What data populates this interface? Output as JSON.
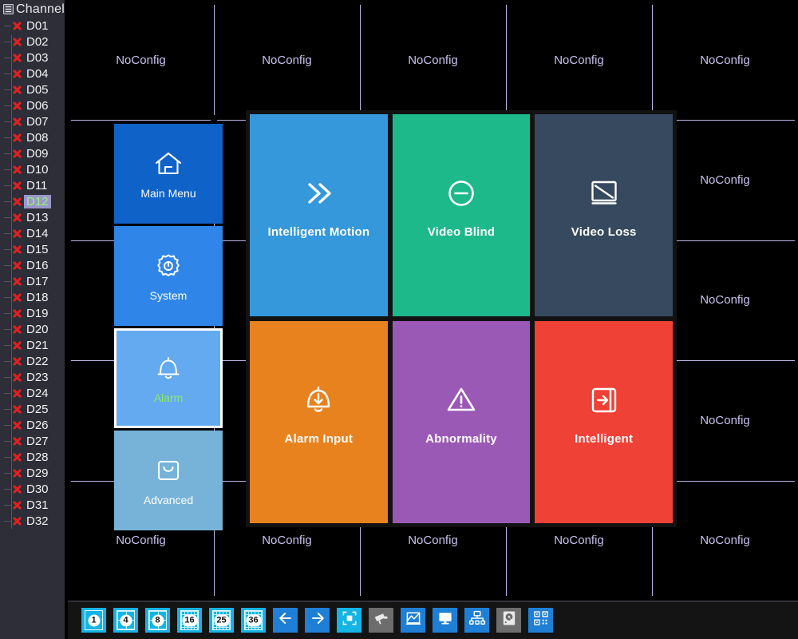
{
  "sidebar": {
    "header": {
      "label": "Channel",
      "icon": "list-document-icon"
    },
    "selected_channel": "D12",
    "channels": [
      {
        "id": "D01",
        "status": "offline"
      },
      {
        "id": "D02",
        "status": "offline"
      },
      {
        "id": "D03",
        "status": "offline"
      },
      {
        "id": "D04",
        "status": "offline"
      },
      {
        "id": "D05",
        "status": "offline"
      },
      {
        "id": "D06",
        "status": "offline"
      },
      {
        "id": "D07",
        "status": "offline"
      },
      {
        "id": "D08",
        "status": "offline"
      },
      {
        "id": "D09",
        "status": "offline"
      },
      {
        "id": "D10",
        "status": "offline"
      },
      {
        "id": "D11",
        "status": "offline"
      },
      {
        "id": "D12",
        "status": "offline"
      },
      {
        "id": "D13",
        "status": "offline"
      },
      {
        "id": "D14",
        "status": "offline"
      },
      {
        "id": "D15",
        "status": "offline"
      },
      {
        "id": "D16",
        "status": "offline"
      },
      {
        "id": "D17",
        "status": "offline"
      },
      {
        "id": "D18",
        "status": "offline"
      },
      {
        "id": "D19",
        "status": "offline"
      },
      {
        "id": "D20",
        "status": "offline"
      },
      {
        "id": "D21",
        "status": "offline"
      },
      {
        "id": "D22",
        "status": "offline"
      },
      {
        "id": "D23",
        "status": "offline"
      },
      {
        "id": "D24",
        "status": "offline"
      },
      {
        "id": "D25",
        "status": "offline"
      },
      {
        "id": "D26",
        "status": "offline"
      },
      {
        "id": "D27",
        "status": "offline"
      },
      {
        "id": "D28",
        "status": "offline"
      },
      {
        "id": "D29",
        "status": "offline"
      },
      {
        "id": "D30",
        "status": "offline"
      },
      {
        "id": "D31",
        "status": "offline"
      },
      {
        "id": "D32",
        "status": "offline"
      }
    ]
  },
  "video_grid": {
    "cell_placeholder": "NoConfig",
    "columns": 5,
    "rows": 5,
    "cells": [
      "NoConfig",
      "NoConfig",
      "NoConfig",
      "NoConfig",
      "NoConfig",
      "NoConfig",
      "NoConfig",
      "NoConfig",
      "NoConfig",
      "NoConfig",
      "NoConfig",
      "NoConfig",
      "NoConfig",
      "NoConfig",
      "NoConfig",
      "NoConfig",
      "NoConfig",
      "NoConfig",
      "NoConfig",
      "NoConfig",
      "NoConfig",
      "NoConfig",
      "NoConfig",
      "NoConfig",
      "NoConfig"
    ]
  },
  "menu_column": {
    "items": [
      {
        "label": "Main Menu",
        "icon": "home-icon",
        "color": "#0f63c8",
        "selected": false
      },
      {
        "label": "System",
        "icon": "gear-icon",
        "color": "#2f86e8",
        "selected": false
      },
      {
        "label": "Alarm",
        "icon": "bell-icon",
        "color": "#63aaf0",
        "selected": true
      },
      {
        "label": "Advanced",
        "icon": "toolbox-icon",
        "color": "#77b3d8",
        "selected": false
      }
    ]
  },
  "tiles": [
    {
      "label": "Intelligent Motion",
      "icon": "double-chevron-right-icon",
      "color": "#3498db"
    },
    {
      "label": "Video Blind",
      "icon": "minus-circle-icon",
      "color": "#1eb98a"
    },
    {
      "label": "Video Loss",
      "icon": "monitor-slash-icon",
      "color": "#37495e"
    },
    {
      "label": "Alarm Input",
      "icon": "bell-down-arrow-icon",
      "color": "#e8821e"
    },
    {
      "label": "Abnormality",
      "icon": "warning-triangle-icon",
      "color": "#9b59b6"
    },
    {
      "label": "Intelligent",
      "icon": "arrow-into-box-icon",
      "color": "#ef4136"
    }
  ],
  "toolbar": {
    "buttons": [
      {
        "name": "split-1",
        "label": "1",
        "icon": "split-screen-1-icon",
        "style": "cyan",
        "active": true
      },
      {
        "name": "split-4",
        "label": "4",
        "icon": "split-screen-4-icon",
        "style": "cyan"
      },
      {
        "name": "split-8",
        "label": "8",
        "icon": "split-screen-8-icon",
        "style": "cyan"
      },
      {
        "name": "split-16",
        "label": "16",
        "icon": "split-screen-16-icon",
        "style": "cyan"
      },
      {
        "name": "split-25",
        "label": "25",
        "icon": "split-screen-25-icon",
        "style": "cyan"
      },
      {
        "name": "split-36",
        "label": "36",
        "icon": "split-screen-36-icon",
        "style": "cyan"
      },
      {
        "name": "previous-page",
        "label": "",
        "icon": "arrow-left-icon",
        "style": "blue"
      },
      {
        "name": "next-page",
        "label": "",
        "icon": "arrow-right-icon",
        "style": "blue"
      },
      {
        "name": "fullscreen",
        "label": "",
        "icon": "focus-square-icon",
        "style": "cyan"
      },
      {
        "name": "ptz-camera",
        "label": "",
        "icon": "camera-icon",
        "style": "gray"
      },
      {
        "name": "color-setting",
        "label": "",
        "icon": "chart-graph-icon",
        "style": "blue"
      },
      {
        "name": "output-adjust",
        "label": "",
        "icon": "monitor-icon",
        "style": "blue"
      },
      {
        "name": "remote-device",
        "label": "",
        "icon": "network-tree-icon",
        "style": "blue"
      },
      {
        "name": "disk-manager",
        "label": "",
        "icon": "hard-disk-icon",
        "style": "gray"
      },
      {
        "name": "qr-code",
        "label": "",
        "icon": "qr-code-icon",
        "style": "blue"
      }
    ]
  },
  "colors": {
    "grid_line": "#bfb5e8",
    "grid_text": "#c9c2ee",
    "sidebar_bg": "#2e2e38",
    "selection_bg": "#9a97c9",
    "selection_text": "#8ce86a",
    "offline_x": "#e02020"
  }
}
